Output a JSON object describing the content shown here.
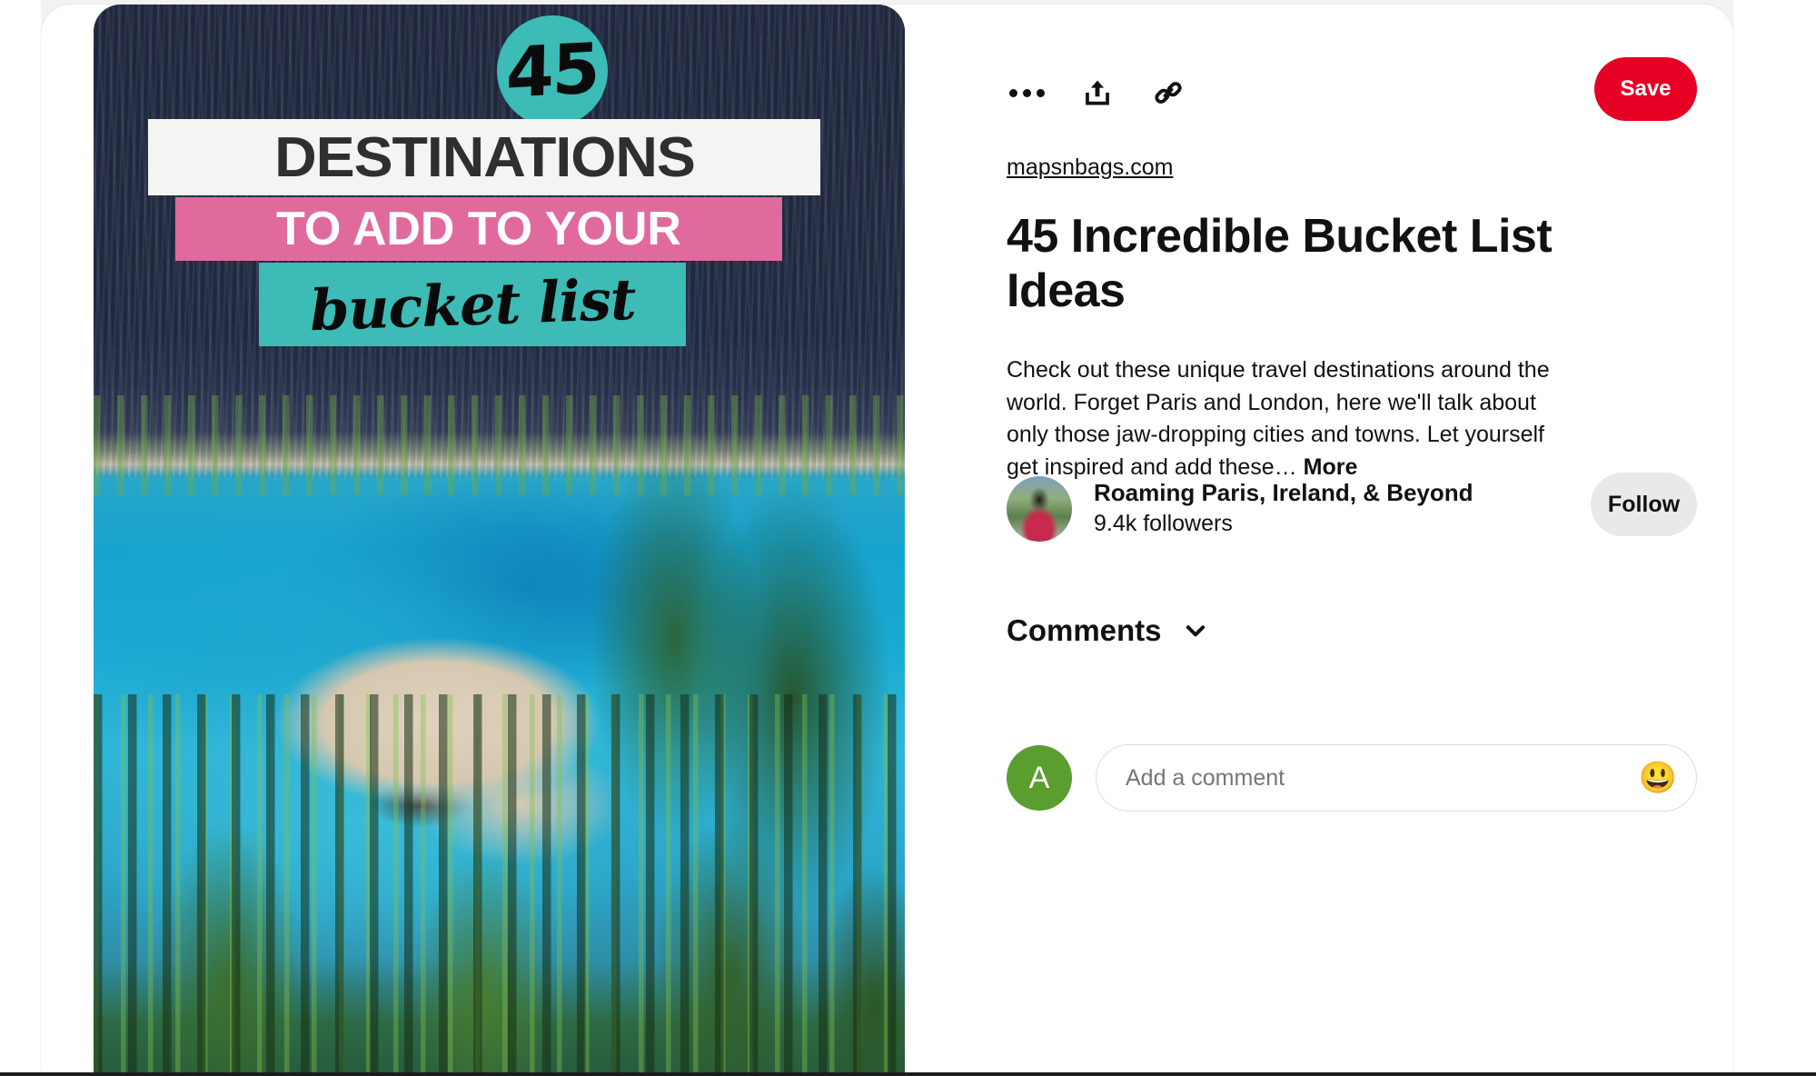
{
  "pin_image": {
    "alt": "Aerial view of a turquoise alpine lake with sandy peninsula surrounded by evergreen forest",
    "overlay": {
      "badge_number": "45",
      "headline": "DESTINATIONS",
      "subline": "TO ADD TO YOUR",
      "script_line": "bucket list"
    },
    "colors": {
      "teal": "#3dbbb6",
      "pink": "#e06a9c",
      "band_white": "#f4f4f2",
      "headline_text": "#2f2f2f"
    }
  },
  "actions": {
    "more_options_label": "More options",
    "share_label": "Share",
    "copy_link_label": "Copy link",
    "save_label": "Save",
    "save_color": "#e60023"
  },
  "pin": {
    "source": "mapsnbags.com",
    "title": "45 Incredible Bucket List Ideas",
    "description": "Check out these unique travel destinations around the world. Forget Paris and London, here we'll talk about only those jaw-dropping cities and towns. Let yourself get inspired and add these…",
    "more_label": "More"
  },
  "author": {
    "name": "Roaming Paris, Ireland, & Beyond",
    "followers": "9.4k followers",
    "follow_label": "Follow"
  },
  "comments": {
    "heading": "Comments",
    "user_initial": "A",
    "user_avatar_color": "#5a9e2f",
    "placeholder": "Add a comment",
    "emoji_glyph": "😃"
  }
}
